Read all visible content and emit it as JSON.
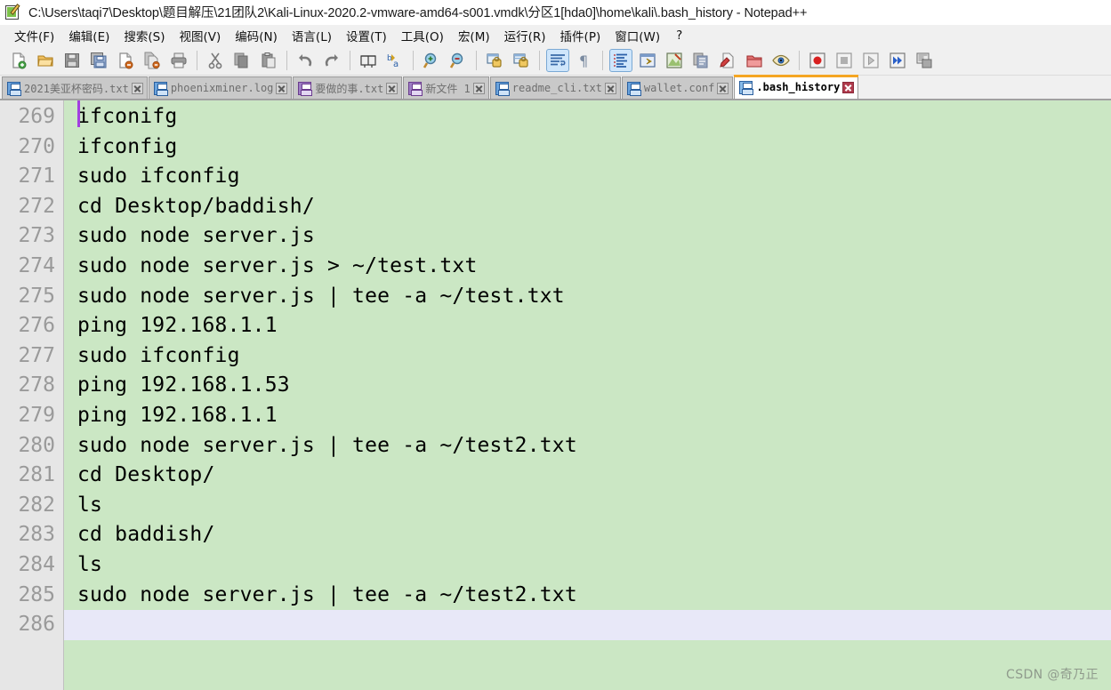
{
  "window": {
    "title": "C:\\Users\\taqi7\\Desktop\\题目解压\\21团队2\\Kali-Linux-2020.2-vmware-amd64-s001.vmdk\\分区1[hda0]\\home\\kali\\.bash_history - Notepad++",
    "app_icon": "notepad-plus-plus-icon"
  },
  "menubar": {
    "items": [
      {
        "label": "文件(F)",
        "name": "menu-file"
      },
      {
        "label": "编辑(E)",
        "name": "menu-edit"
      },
      {
        "label": "搜索(S)",
        "name": "menu-search"
      },
      {
        "label": "视图(V)",
        "name": "menu-view"
      },
      {
        "label": "编码(N)",
        "name": "menu-encoding"
      },
      {
        "label": "语言(L)",
        "name": "menu-language"
      },
      {
        "label": "设置(T)",
        "name": "menu-settings"
      },
      {
        "label": "工具(O)",
        "name": "menu-tools"
      },
      {
        "label": "宏(M)",
        "name": "menu-macro"
      },
      {
        "label": "运行(R)",
        "name": "menu-run"
      },
      {
        "label": "插件(P)",
        "name": "menu-plugins"
      },
      {
        "label": "窗口(W)",
        "name": "menu-window"
      },
      {
        "label": "?",
        "name": "menu-help"
      }
    ]
  },
  "toolbar": {
    "groups": [
      [
        {
          "icon": "new-file-icon",
          "name": "toolbar-new"
        },
        {
          "icon": "open-file-icon",
          "name": "toolbar-open"
        },
        {
          "icon": "save-icon",
          "name": "toolbar-save"
        },
        {
          "icon": "save-all-icon",
          "name": "toolbar-save-all"
        },
        {
          "icon": "close-file-icon",
          "name": "toolbar-close"
        },
        {
          "icon": "close-all-icon",
          "name": "toolbar-close-all"
        },
        {
          "icon": "print-icon",
          "name": "toolbar-print"
        }
      ],
      [
        {
          "icon": "cut-icon",
          "name": "toolbar-cut"
        },
        {
          "icon": "copy-icon",
          "name": "toolbar-copy"
        },
        {
          "icon": "paste-icon",
          "name": "toolbar-paste"
        }
      ],
      [
        {
          "icon": "undo-icon",
          "name": "toolbar-undo"
        },
        {
          "icon": "redo-icon",
          "name": "toolbar-redo"
        }
      ],
      [
        {
          "icon": "find-icon",
          "name": "toolbar-find"
        },
        {
          "icon": "replace-icon",
          "name": "toolbar-replace"
        }
      ],
      [
        {
          "icon": "zoom-in-icon",
          "name": "toolbar-zoom-in"
        },
        {
          "icon": "zoom-out-icon",
          "name": "toolbar-zoom-out"
        }
      ],
      [
        {
          "icon": "sync-vertical-scroll-icon",
          "name": "toolbar-sync-v-scroll"
        },
        {
          "icon": "sync-horizontal-scroll-icon",
          "name": "toolbar-sync-h-scroll"
        }
      ],
      [
        {
          "icon": "word-wrap-icon",
          "name": "toolbar-word-wrap",
          "toggled": true
        },
        {
          "icon": "show-all-characters-icon",
          "name": "toolbar-show-all-chars"
        }
      ],
      [
        {
          "icon": "indent-guide-icon",
          "name": "toolbar-indent-guide",
          "toggled": true
        },
        {
          "icon": "user-defined-dialog-icon",
          "name": "toolbar-user-defined-dialog"
        },
        {
          "icon": "document-map-icon",
          "name": "toolbar-document-map"
        },
        {
          "icon": "function-list-icon",
          "name": "toolbar-function-list"
        },
        {
          "icon": "document-switcher-icon",
          "name": "toolbar-document-switcher"
        },
        {
          "icon": "folder-as-workspace-icon",
          "name": "toolbar-folder-workspace"
        },
        {
          "icon": "monitoring-icon",
          "name": "toolbar-monitoring"
        }
      ],
      [
        {
          "icon": "macro-record-icon",
          "name": "toolbar-macro-record"
        },
        {
          "icon": "macro-stop-icon",
          "name": "toolbar-macro-stop"
        },
        {
          "icon": "macro-play-icon",
          "name": "toolbar-macro-play"
        },
        {
          "icon": "macro-run-multiple-icon",
          "name": "toolbar-macro-run-multiple"
        },
        {
          "icon": "macro-save-icon",
          "name": "toolbar-macro-save"
        }
      ]
    ]
  },
  "tabs": [
    {
      "label": "2021美亚杯密码.txt",
      "active": false,
      "modified": false,
      "name": "tab-2021meiyabei"
    },
    {
      "label": "phoenixminer.log",
      "active": false,
      "modified": false,
      "name": "tab-phoenixminer-log"
    },
    {
      "label": "要做的事.txt",
      "active": false,
      "modified": true,
      "name": "tab-yaozuodeshi"
    },
    {
      "label": "新文件 1",
      "active": false,
      "modified": true,
      "name": "tab-new-file-1"
    },
    {
      "label": "readme_cli.txt",
      "active": false,
      "modified": false,
      "name": "tab-readme-cli"
    },
    {
      "label": "wallet.conf",
      "active": false,
      "modified": false,
      "name": "tab-wallet-conf"
    },
    {
      "label": ".bash_history",
      "active": true,
      "modified": false,
      "name": "tab-bash-history"
    }
  ],
  "editor": {
    "first_line_number": 269,
    "cursor_line": 286,
    "lines": [
      {
        "num": "269",
        "text": "ifconifg"
      },
      {
        "num": "270",
        "text": "ifconfig"
      },
      {
        "num": "271",
        "text": "sudo ifconfig"
      },
      {
        "num": "272",
        "text": "cd Desktop/baddish/"
      },
      {
        "num": "273",
        "text": "sudo node server.js"
      },
      {
        "num": "274",
        "text": "sudo node server.js > ~/test.txt"
      },
      {
        "num": "275",
        "text": "sudo node server.js | tee -a ~/test.txt"
      },
      {
        "num": "276",
        "text": "ping 192.168.1.1"
      },
      {
        "num": "277",
        "text": "sudo ifconfig"
      },
      {
        "num": "278",
        "text": "ping 192.168.1.53"
      },
      {
        "num": "279",
        "text": "ping 192.168.1.1"
      },
      {
        "num": "280",
        "text": "sudo node server.js | tee -a ~/test2.txt"
      },
      {
        "num": "281",
        "text": "cd Desktop/"
      },
      {
        "num": "282",
        "text": "ls"
      },
      {
        "num": "283",
        "text": "cd baddish/"
      },
      {
        "num": "284",
        "text": "ls"
      },
      {
        "num": "285",
        "text": "sudo node server.js | tee -a ~/test2.txt"
      },
      {
        "num": "286",
        "text": ""
      }
    ],
    "colors": {
      "background": "#cbe7c4",
      "text": "#000000",
      "gutter_background": "#e6e6e6",
      "gutter_text": "#9a9a9a",
      "current_line": "#e8e8f8",
      "caret": "#a23fe0",
      "active_tab_accent": "#f5a623"
    }
  },
  "watermark": {
    "text": "CSDN @奇乃正"
  }
}
